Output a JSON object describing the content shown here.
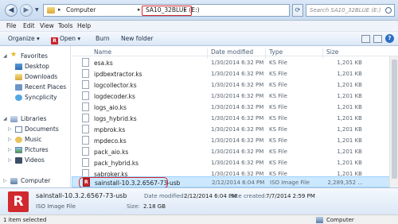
{
  "address": {
    "crumbs": [
      "Computer",
      "SA10_32BLUE (E:)"
    ],
    "search_placeholder": "Search SA10_32BLUE (E:)"
  },
  "menu": [
    "File",
    "Edit",
    "View",
    "Tools",
    "Help"
  ],
  "toolbar": {
    "organize": "Organize ▾",
    "open": "Open ▾",
    "burn": "Burn",
    "new_folder": "New folder"
  },
  "nav": {
    "favorites": "Favorites",
    "desktop": "Desktop",
    "downloads": "Downloads",
    "recent": "Recent Places",
    "syncplicity": "Syncplicity",
    "libraries": "Libraries",
    "documents": "Documents",
    "music": "Music",
    "pictures": "Pictures",
    "videos": "Videos",
    "computer": "Computer"
  },
  "columns": {
    "name": "Name",
    "date": "Date modified",
    "type": "Type",
    "size": "Size"
  },
  "files": [
    {
      "name": "esa.ks",
      "date": "1/30/2014 6:32 PM",
      "type": "KS File",
      "size": "1,201 KB"
    },
    {
      "name": "ipdbextractor.ks",
      "date": "1/30/2014 6:32 PM",
      "type": "KS File",
      "size": "1,201 KB"
    },
    {
      "name": "logcollector.ks",
      "date": "1/30/2014 6:32 PM",
      "type": "KS File",
      "size": "1,201 KB"
    },
    {
      "name": "logdecoder.ks",
      "date": "1/30/2014 6:32 PM",
      "type": "KS File",
      "size": "1,201 KB"
    },
    {
      "name": "logs_aio.ks",
      "date": "1/30/2014 6:32 PM",
      "type": "KS File",
      "size": "1,201 KB"
    },
    {
      "name": "logs_hybrid.ks",
      "date": "1/30/2014 6:32 PM",
      "type": "KS File",
      "size": "1,201 KB"
    },
    {
      "name": "mpbrok.ks",
      "date": "1/30/2014 6:32 PM",
      "type": "KS File",
      "size": "1,201 KB"
    },
    {
      "name": "mpdeco.ks",
      "date": "1/30/2014 6:32 PM",
      "type": "KS File",
      "size": "1,201 KB"
    },
    {
      "name": "pack_aio.ks",
      "date": "1/30/2014 6:32 PM",
      "type": "KS File",
      "size": "1,201 KB"
    },
    {
      "name": "pack_hybrid.ks",
      "date": "1/30/2014 6:32 PM",
      "type": "KS File",
      "size": "1,201 KB"
    },
    {
      "name": "sabroker.ks",
      "date": "1/30/2014 6:32 PM",
      "type": "KS File",
      "size": "1,201 KB"
    },
    {
      "name": "sainstall-10.3.2.6567-73-usb",
      "date": "2/12/2014 6:04 PM",
      "type": "ISO Image File",
      "size": "2,289,352 ..."
    }
  ],
  "details": {
    "name": "sainstall-10.3.2.6567-73-usb",
    "type": "ISO Image File",
    "date_modified_label": "Date modified:",
    "date_modified": "2/12/2014 6:04 PM",
    "date_created_label": "Date created:",
    "date_created": "7/7/2014 2:59 PM",
    "size_label": "Size:",
    "size": "2.18 GB"
  },
  "status": {
    "selection": "1 item selected",
    "location": "Computer"
  },
  "colors": {
    "highlight": "#d6262a",
    "selected_row": "#cce8ff",
    "accent": "#c8252b"
  }
}
